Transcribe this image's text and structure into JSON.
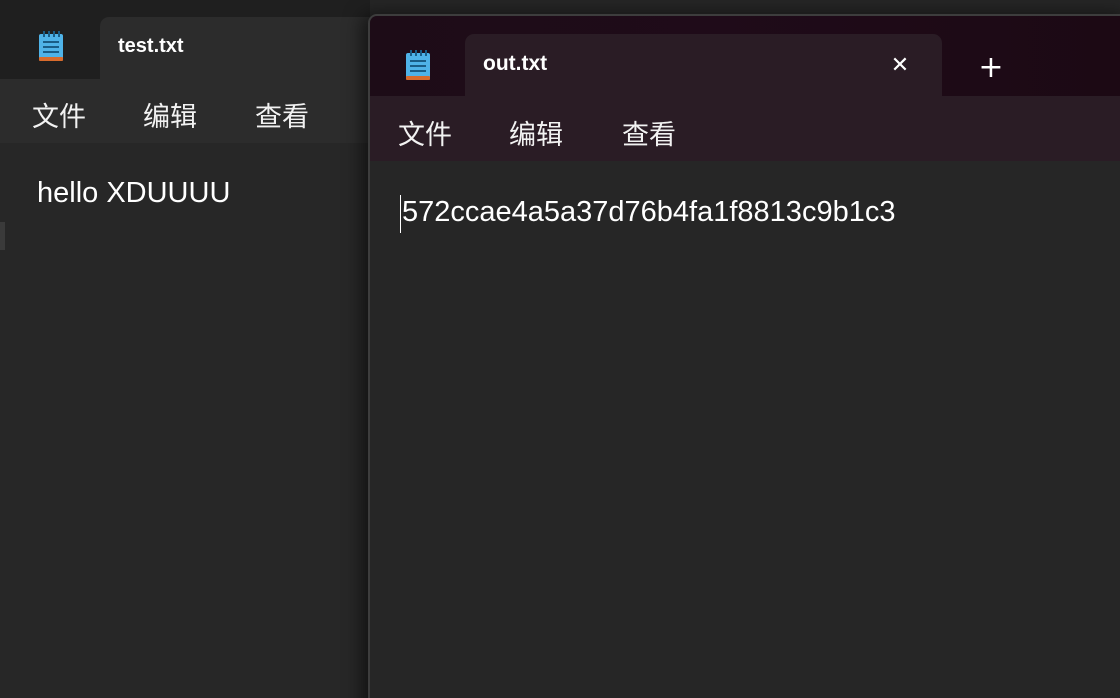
{
  "back_window": {
    "tab_title": "test.txt",
    "menu": [
      "文件",
      "编辑",
      "查看"
    ],
    "content": "hello XDUUUU",
    "icon": "notepad-icon"
  },
  "front_window": {
    "tab_title": "out.txt",
    "menu": [
      "文件",
      "编辑",
      "查看"
    ],
    "content": "572ccae4a5a37d76b4fa1f8813c9b1c3",
    "icon": "notepad-icon",
    "close_glyph": "✕",
    "new_tab_glyph": "+"
  },
  "colors": {
    "editor_bg": "#262626",
    "tabbar_front": "#1f0b19",
    "menubar_front": "#2a1c25",
    "text": "#ffffff"
  }
}
